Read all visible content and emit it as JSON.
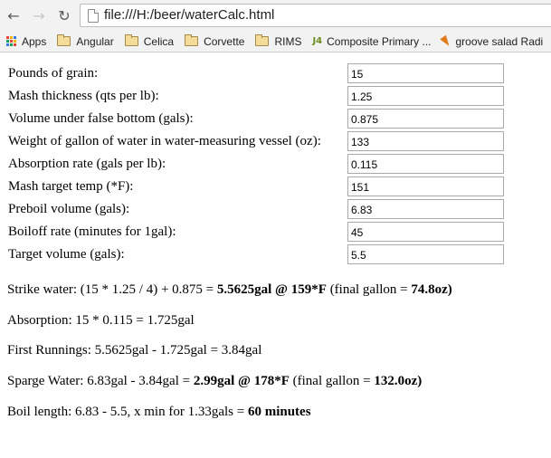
{
  "browser": {
    "url": "file:///H:/beer/waterCalc.html",
    "bookmarks": [
      {
        "label": "Apps",
        "icon": "apps-grid-icon"
      },
      {
        "label": "Angular",
        "icon": "folder-icon"
      },
      {
        "label": "Celica",
        "icon": "folder-icon"
      },
      {
        "label": "Corvette",
        "icon": "folder-icon"
      },
      {
        "label": "RIMS",
        "icon": "folder-icon"
      },
      {
        "label": "Composite Primary ...",
        "icon": "j4-icon"
      },
      {
        "label": "groove salad Radi",
        "icon": "carrot-icon"
      }
    ]
  },
  "form": {
    "fields": [
      {
        "label": "Pounds of grain:",
        "value": "15"
      },
      {
        "label": "Mash thickness (qts per lb):",
        "value": "1.25"
      },
      {
        "label": "Volume under false bottom (gals):",
        "value": "0.875"
      },
      {
        "label": "Weight of gallon of water in water-measuring vessel (oz):",
        "value": "133"
      },
      {
        "label": "Absorption rate (gals per lb):",
        "value": "0.115"
      },
      {
        "label": "Mash target temp (*F):",
        "value": "151"
      },
      {
        "label": "Preboil volume (gals):",
        "value": "6.83"
      },
      {
        "label": "Boiloff rate (minutes for 1gal):",
        "value": "45"
      },
      {
        "label": "Target volume (gals):",
        "value": "5.5"
      }
    ]
  },
  "results": {
    "strike": {
      "prefix": "Strike water: (15 * 1.25 / 4) + 0.875 = ",
      "bold1": "5.5625gal @ 159*F",
      "mid": " (final gallon = ",
      "bold2": "74.8oz)"
    },
    "absorption": {
      "text": "Absorption: 15 * 0.115 = 1.725gal"
    },
    "first_runnings": {
      "text": "First Runnings: 5.5625gal - 1.725gal = 3.84gal"
    },
    "sparge": {
      "prefix": "Sparge Water: 6.83gal - 3.84gal = ",
      "bold1": "2.99gal @ 178*F",
      "mid": " (final gallon = ",
      "bold2": "132.0oz)"
    },
    "boil": {
      "prefix": "Boil length: 6.83 - 5.5, x min for 1.33gals = ",
      "bold1": "60 minutes"
    }
  },
  "colors": {
    "apps_grid": [
      "#e8433a",
      "#f4b400",
      "#3b78e7",
      "#0f9d58",
      "#e8433a",
      "#f4b400",
      "#3b78e7",
      "#0f9d58",
      "#e8433a"
    ]
  }
}
